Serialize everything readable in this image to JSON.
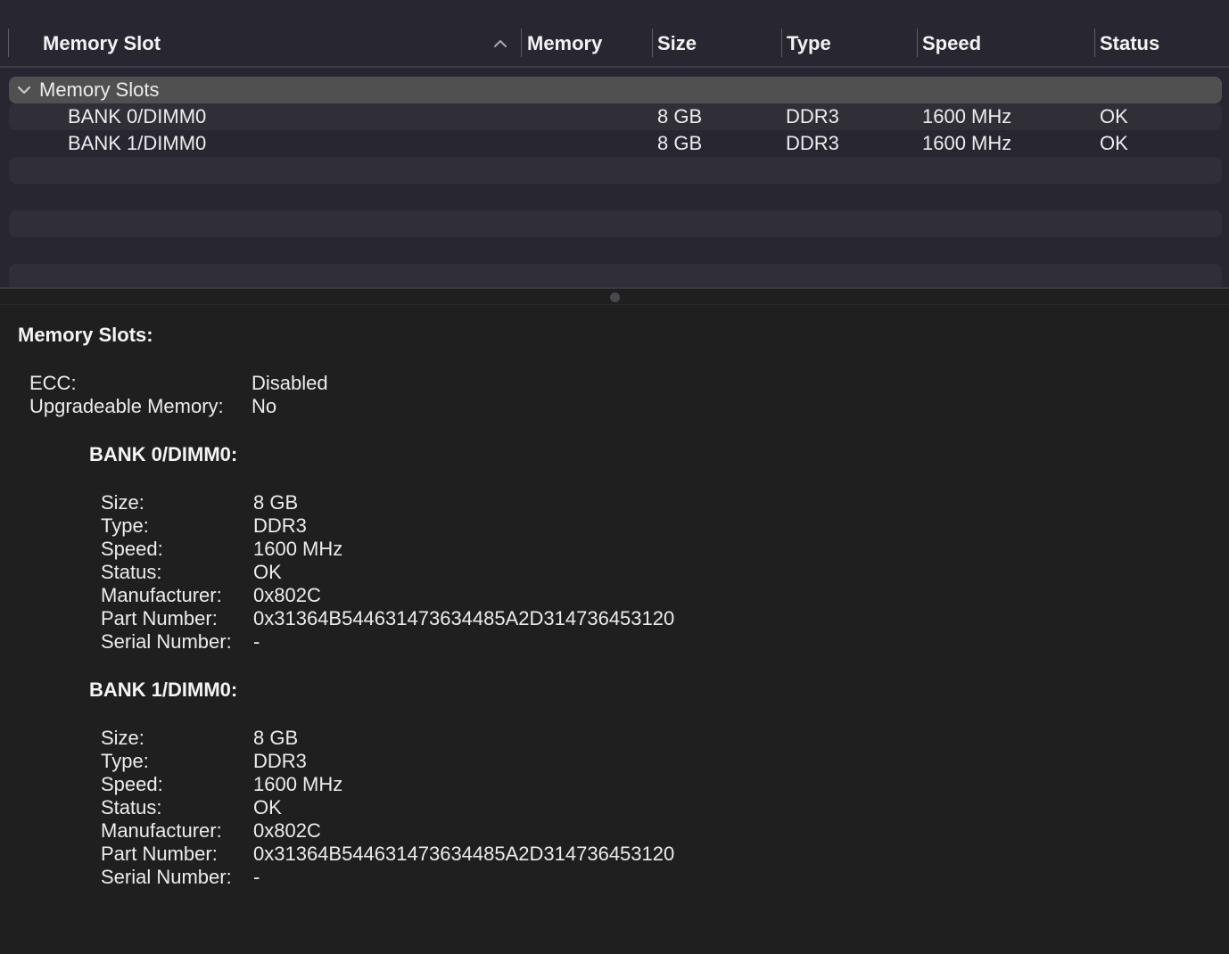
{
  "table": {
    "columns": {
      "memory_slot": "Memory Slot",
      "memory": "Memory",
      "size": "Size",
      "type": "Type",
      "speed": "Speed",
      "status": "Status"
    },
    "sort_icon": "chevron-up-icon",
    "group": {
      "label": "Memory Slots",
      "icon": "chevron-down-icon"
    },
    "rows": [
      {
        "slot": "BANK 0/DIMM0",
        "size": "8 GB",
        "type": "DDR3",
        "speed": "1600 MHz",
        "status": "OK"
      },
      {
        "slot": "BANK 1/DIMM0",
        "size": "8 GB",
        "type": "DDR3",
        "speed": "1600 MHz",
        "status": "OK"
      }
    ]
  },
  "detail": {
    "title": "Memory Slots:",
    "ecc_label": "ECC:",
    "ecc_value": "Disabled",
    "upgradeable_label": "Upgradeable Memory:",
    "upgradeable_value": "No",
    "banks": [
      {
        "title": "BANK 0/DIMM0:",
        "size_label": "Size:",
        "size": "8 GB",
        "type_label": "Type:",
        "type": "DDR3",
        "speed_label": "Speed:",
        "speed": "1600 MHz",
        "status_label": "Status:",
        "status": "OK",
        "manufacturer_label": "Manufacturer:",
        "manufacturer": "0x802C",
        "part_label": "Part Number:",
        "part": "0x31364B544631473634485A2D314736453120",
        "serial_label": "Serial Number:",
        "serial": "-"
      },
      {
        "title": "BANK 1/DIMM0:",
        "size_label": "Size:",
        "size": "8 GB",
        "type_label": "Type:",
        "type": "DDR3",
        "speed_label": "Speed:",
        "speed": "1600 MHz",
        "status_label": "Status:",
        "status": "OK",
        "manufacturer_label": "Manufacturer:",
        "manufacturer": "0x802C",
        "part_label": "Part Number:",
        "part": "0x31364B544631473634485A2D314736453120",
        "serial_label": "Serial Number:",
        "serial": "-"
      }
    ]
  }
}
